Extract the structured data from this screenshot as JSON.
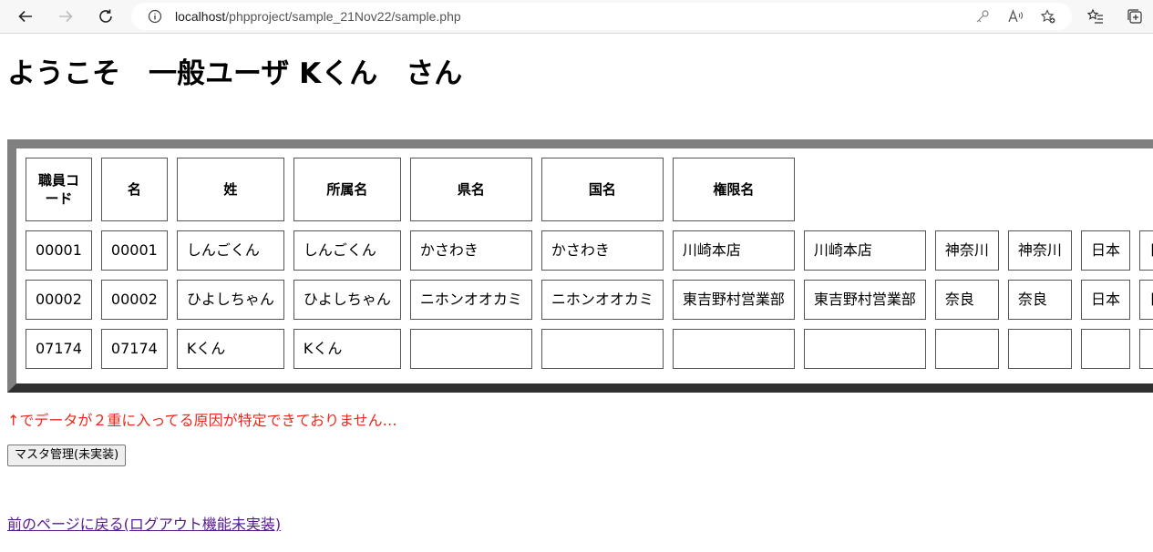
{
  "browser": {
    "url_host": "localhost",
    "url_path": "/phpproject/sample_21Nov22/sample.php"
  },
  "page": {
    "heading": "ようこそ　一般ユーザ Kくん　さん",
    "table": {
      "headers": [
        "職員コード",
        "名",
        "姓",
        "所属名",
        "県名",
        "国名",
        "権限名"
      ],
      "rows": [
        [
          "00001",
          "00001",
          "しんごくん",
          "しんごくん",
          "かさわき",
          "かさわき",
          "川崎本店",
          "川崎本店",
          "神奈川",
          "神奈川",
          "日本",
          "日本"
        ],
        [
          "00002",
          "00002",
          "ひよしちゃん",
          "ひよしちゃん",
          "ニホンオオカミ",
          "ニホンオオカミ",
          "東吉野村営業部",
          "東吉野村営業部",
          "奈良",
          "奈良",
          "日本",
          "日本"
        ],
        [
          "07174",
          "07174",
          "Kくん",
          "Kくん",
          "",
          "",
          "",
          "",
          "",
          "",
          "",
          ""
        ]
      ]
    },
    "warning": "↑でデータが２重に入ってる原因が特定できておりません…",
    "master_button": "マスタ管理(未実装)",
    "back_link": "前のページに戻る(ログアウト機能未実装)"
  },
  "colors": {
    "warning": "#e8291c",
    "link_visited": "#551a8b"
  }
}
